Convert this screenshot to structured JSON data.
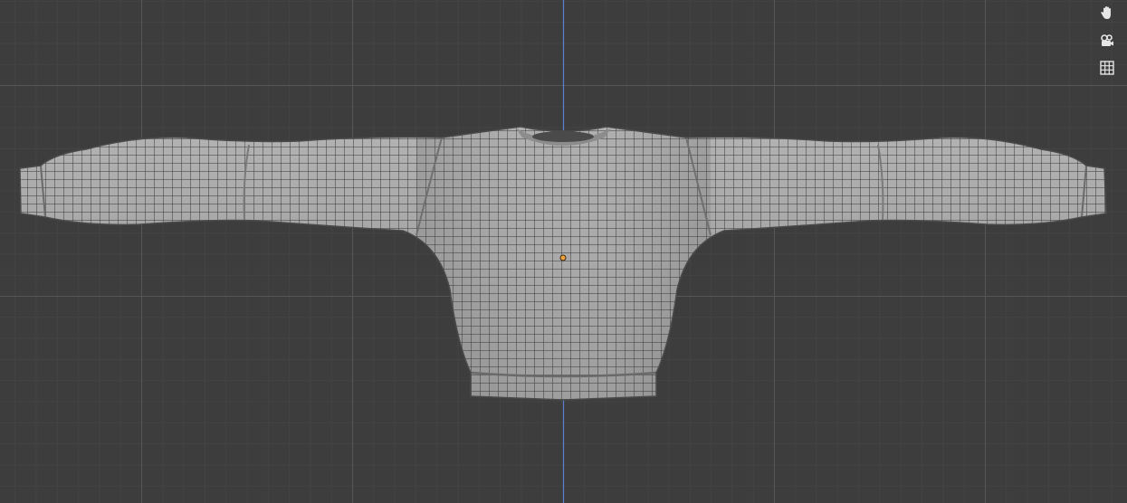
{
  "app": "Blender",
  "viewport": {
    "view": "front-orthographic",
    "background_color": "#3d3d3d",
    "grid_minor_color": "#444444",
    "grid_major_color": "#565656",
    "z_axis_color": "#5a7fcf",
    "object": {
      "name": "sweater-mesh",
      "display": "solid-wireframe",
      "mesh_color": "#a6a6a6",
      "wire_color": "#3a3a3a",
      "origin_color": "#f0a23c"
    }
  },
  "navigation_gizmo": {
    "buttons": [
      {
        "icon": "hand-pan-icon",
        "action": "pan"
      },
      {
        "icon": "camera-icon",
        "action": "toggle-camera-view"
      },
      {
        "icon": "grid-ortho-icon",
        "action": "toggle-orthographic"
      }
    ]
  }
}
